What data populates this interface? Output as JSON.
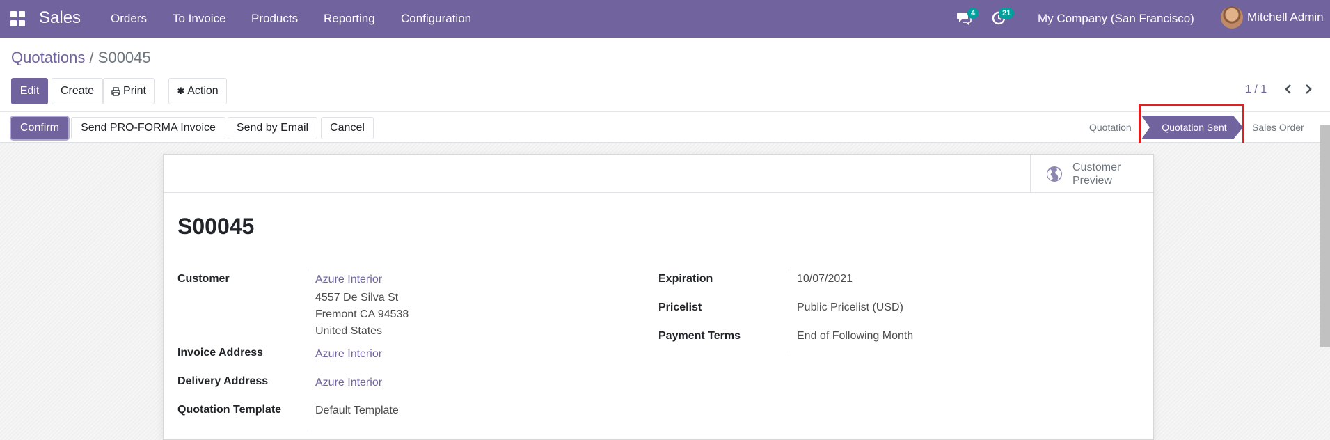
{
  "navbar": {
    "app_name": "Sales",
    "menu": [
      "Orders",
      "To Invoice",
      "Products",
      "Reporting",
      "Configuration"
    ],
    "chat_count": "4",
    "activity_count": "21",
    "company": "My Company (San Francisco)",
    "user": "Mitchell Admin",
    "color": "#71639e"
  },
  "breadcrumb": {
    "parent": "Quotations",
    "separator": "/",
    "current": "S00045"
  },
  "control": {
    "edit": "Edit",
    "create": "Create",
    "print": "Print",
    "action": "Action",
    "pager": "1 / 1"
  },
  "statusbar": {
    "buttons": [
      "Confirm",
      "Send PRO-FORMA Invoice",
      "Send by Email",
      "Cancel"
    ],
    "stages": [
      "Quotation",
      "Quotation Sent",
      "Sales Order"
    ],
    "active_stage": "Quotation Sent"
  },
  "form": {
    "smart_button": {
      "line1": "Customer",
      "line2": "Preview"
    },
    "title": "S00045",
    "left": {
      "customer_label": "Customer",
      "customer_name": "Azure Interior",
      "address_line1": "4557 De Silva St",
      "address_line2": "Fremont CA 94538",
      "address_line3": "United States",
      "invoice_label": "Invoice Address",
      "invoice_value": "Azure Interior",
      "delivery_label": "Delivery Address",
      "delivery_value": "Azure Interior",
      "template_label": "Quotation Template",
      "template_value": "Default Template"
    },
    "right": {
      "expiration_label": "Expiration",
      "expiration_value": "10/07/2021",
      "pricelist_label": "Pricelist",
      "pricelist_value": "Public Pricelist (USD)",
      "terms_label": "Payment Terms",
      "terms_value": "End of Following Month"
    }
  },
  "colors": {
    "accent": "#71639e",
    "badge": "#00a09d",
    "highlight": "#e02020"
  }
}
